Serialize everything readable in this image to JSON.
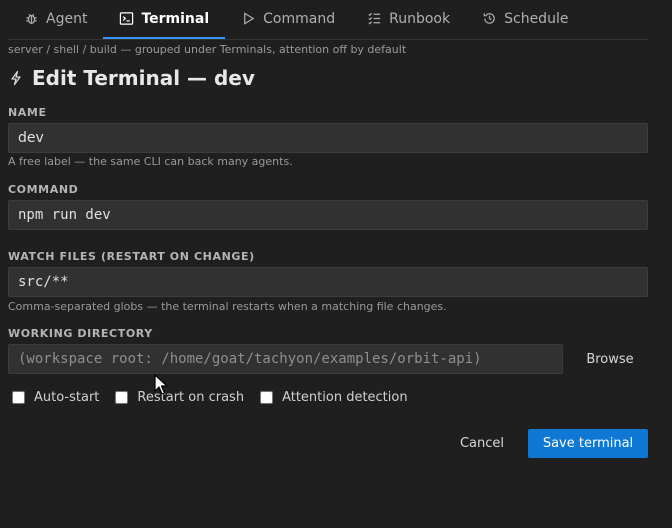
{
  "tabs": [
    {
      "label": "Agent",
      "icon": "bug-icon",
      "active": false
    },
    {
      "label": "Terminal",
      "icon": "terminal-icon",
      "active": true
    },
    {
      "label": "Command",
      "icon": "play-icon",
      "active": false
    },
    {
      "label": "Runbook",
      "icon": "checklist-icon",
      "active": false
    },
    {
      "label": "Schedule",
      "icon": "history-icon",
      "active": false
    }
  ],
  "hint": "server / shell / build — grouped under Terminals, attention off by default",
  "page_title": "Edit Terminal — dev",
  "form": {
    "name": {
      "label": "NAME",
      "value": "dev",
      "help": "A free label — the same CLI can back many agents."
    },
    "command": {
      "label": "COMMAND",
      "value": "npm run dev"
    },
    "watch": {
      "label": "WATCH FILES (RESTART ON CHANGE)",
      "value": "src/**",
      "help": "Comma-separated globs — the terminal restarts when a matching file changes."
    },
    "workdir": {
      "label": "WORKING DIRECTORY",
      "value": "",
      "placeholder": "(workspace root: /home/goat/tachyon/examples/orbit-api)",
      "browse_label": "Browse"
    },
    "options": [
      {
        "label": "Auto-start",
        "checked": false
      },
      {
        "label": "Restart on crash",
        "checked": false
      },
      {
        "label": "Attention detection",
        "checked": false
      }
    ]
  },
  "actions": {
    "cancel_label": "Cancel",
    "save_label": "Save terminal"
  },
  "colors": {
    "accent": "#3794ff",
    "primary_button": "#0e78d4",
    "background": "#1f1f1f",
    "input_background": "#313131"
  }
}
